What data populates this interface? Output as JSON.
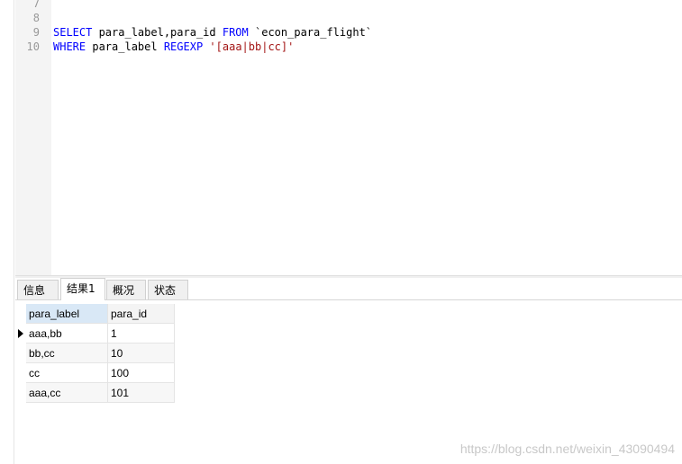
{
  "editor": {
    "line_numbers": [
      "7",
      "8",
      "9",
      "10"
    ],
    "line9": {
      "kw1": "SELECT",
      "t1": " para_label,para_id ",
      "kw2": "FROM",
      "t2": " `econ_para_flight`"
    },
    "line10": {
      "kw1": "WHERE",
      "t1": " para_label ",
      "kw2": "REGEXP",
      "t2": " ",
      "str": "'[aaa|bb|cc]'"
    }
  },
  "tabs": [
    {
      "label": "信息"
    },
    {
      "label": "结果1"
    },
    {
      "label": "概况"
    },
    {
      "label": "状态"
    }
  ],
  "table": {
    "columns": [
      "para_label",
      "para_id"
    ],
    "rows": [
      [
        "aaa,bb",
        "1"
      ],
      [
        "bb,cc",
        "10"
      ],
      [
        "cc",
        "100"
      ],
      [
        "aaa,cc",
        "101"
      ]
    ]
  },
  "watermark": "https://blog.csdn.net/weixin_43090494",
  "colors": {
    "keyword": "#0000ff",
    "string": "#a31515",
    "selected_header": "#d9e8f6"
  }
}
